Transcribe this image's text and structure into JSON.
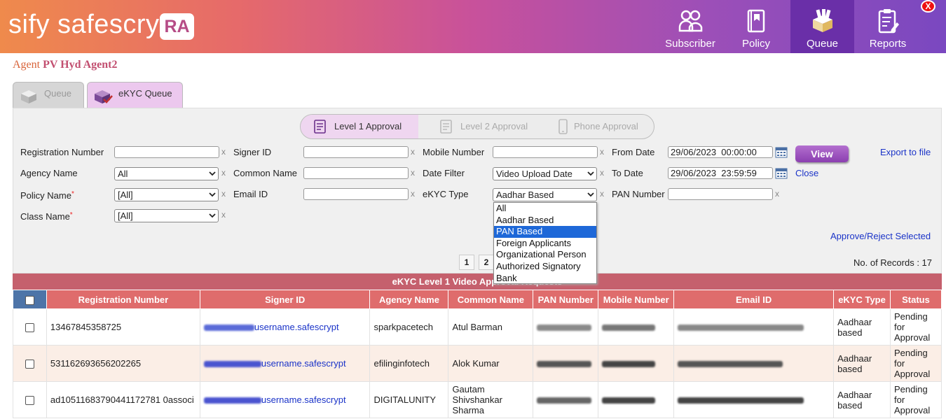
{
  "header": {
    "logo_text": "sify safescrypt",
    "logo_badge": "RA",
    "close_label": "X",
    "nav": [
      {
        "label": "Subscriber",
        "icon": "people-icon"
      },
      {
        "label": "Policy",
        "icon": "policy-book-icon"
      },
      {
        "label": "Queue",
        "icon": "queue-boxes-icon"
      },
      {
        "label": "Reports",
        "icon": "report-clipboard-icon"
      }
    ]
  },
  "agent": {
    "prefix": "Agent",
    "name": "PV Hyd Agent2"
  },
  "tabs": [
    {
      "label": "Queue"
    },
    {
      "label": "eKYC Queue"
    }
  ],
  "approval_levels": [
    {
      "label": "Level 1 Approval"
    },
    {
      "label": "Level 2 Approval"
    },
    {
      "label": "Phone Approval"
    }
  ],
  "filters": {
    "registration_number": {
      "label": "Registration Number",
      "value": ""
    },
    "signer_id": {
      "label": "Signer ID",
      "value": ""
    },
    "mobile_number": {
      "label": "Mobile Number",
      "value": ""
    },
    "from_date": {
      "label": "From Date",
      "value": "29/06/2023  00:00:00"
    },
    "agency_name": {
      "label": "Agency Name",
      "value": "All"
    },
    "common_name": {
      "label": "Common Name",
      "value": ""
    },
    "date_filter": {
      "label": "Date Filter",
      "value": "Video Upload Date"
    },
    "to_date": {
      "label": "To Date",
      "value": "29/06/2023  23:59:59"
    },
    "policy_name": {
      "label": "Policy Name",
      "value": "[All]"
    },
    "email_id": {
      "label": "Email ID",
      "value": ""
    },
    "ekyc_type": {
      "label": "eKYC Type",
      "value": "Aadhar Based"
    },
    "pan_number": {
      "label": "PAN Number",
      "value": ""
    },
    "class_name": {
      "label": "Class Name",
      "value": "[All]"
    },
    "clear_mark": "x",
    "required_mark": "*"
  },
  "ekyc_type_options": [
    "All",
    "Aadhar Based",
    "PAN Based",
    "Foreign Applicants",
    "Organizational Person",
    "Authorized Signatory",
    "Bank"
  ],
  "ekyc_type_highlighted": "PAN Based",
  "actions": {
    "view": "View",
    "export": "Export to file",
    "close": "Close",
    "approve_reject": "Approve/Reject Selected"
  },
  "pagination": {
    "pages": [
      "1",
      "2"
    ],
    "records_label": "No. of Records : 17"
  },
  "grid": {
    "title": "eKYC Level 1 Video Approval Requests",
    "columns": [
      "Registration Number",
      "Signer ID",
      "Agency Name",
      "Common Name",
      "PAN Number",
      "Mobile Number",
      "Email ID",
      "eKYC Type",
      "Status"
    ],
    "rows": [
      {
        "registration_number": "13467845358725",
        "signer_id": "username.safescrypt",
        "agency_name": "sparkpacetech",
        "common_name": "Atul Barman",
        "ekyc_type": "Aadhaar based",
        "status": "Pending for Approval"
      },
      {
        "registration_number": "531162693656202265",
        "signer_id": "username.safescrypt",
        "agency_name": "efilinginfotech",
        "common_name": "Alok Kumar",
        "ekyc_type": "Aadhaar based",
        "status": "Pending for Approval"
      },
      {
        "registration_number": "ad10511683790441172781 0associ",
        "signer_id": "username.safescrypt",
        "agency_name": "DIGITALUNITY",
        "common_name": "Gautam Shivshankar Sharma",
        "ekyc_type": "Aadhaar based",
        "status": "Pending for Approval"
      }
    ]
  }
}
